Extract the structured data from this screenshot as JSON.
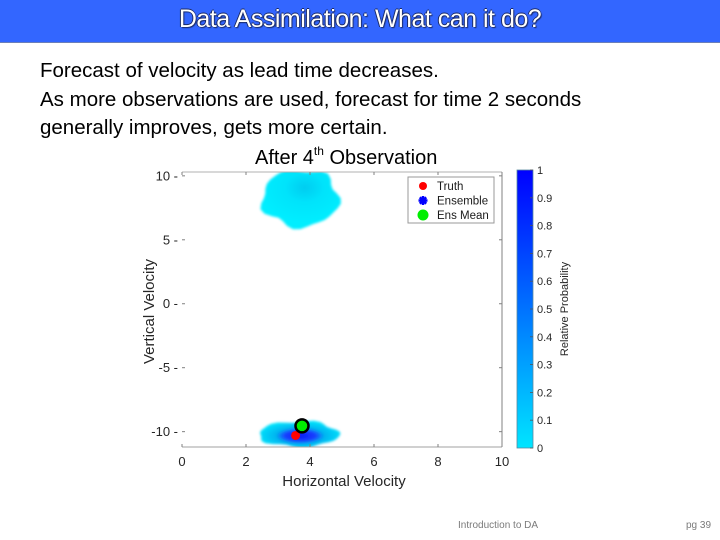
{
  "slide": {
    "title": "Data Assimilation: What can it do?",
    "body_lines": [
      "Forecast of velocity as lead time decreases.",
      "As more observations are used, forecast for time 2 seconds",
      "generally improves, gets more certain."
    ],
    "footer_left": "Introduction to DA",
    "footer_right": "pg 39"
  },
  "colors": {
    "title_bar": "#3366ff",
    "truth": "#ff0000",
    "ensemble": "#0000ff",
    "ens_mean": "#00ee00",
    "colormap_low": "#00e5ff",
    "colormap_high": "#0000ff"
  },
  "chart_data": {
    "type": "scatter",
    "title_prefix": "After 4",
    "title_sup": "th",
    "title_suffix": " Observation",
    "xlabel": "Horizontal Velocity",
    "ylabel": "Vertical Velocity",
    "xlim": [
      0,
      10
    ],
    "ylim": [
      -11.2,
      10.3
    ],
    "xticks": [
      "0",
      "2",
      "4",
      "6",
      "8",
      "10"
    ],
    "xtick_values": [
      0,
      2,
      4,
      6,
      8,
      10
    ],
    "yticks": [
      "10",
      "5",
      "0",
      "-5",
      "-10"
    ],
    "ytick_values": [
      10,
      5,
      0,
      -5,
      -10
    ],
    "grid": false,
    "legend": {
      "placement": "top-right",
      "entries": [
        "Truth",
        "Ensemble",
        "Ens Mean"
      ]
    },
    "colorbar": {
      "label": "Relative Probability",
      "range": [
        0,
        1
      ],
      "ticks": [
        "0",
        "0.1",
        "0.2",
        "0.3",
        "0.4",
        "0.5",
        "0.6",
        "0.7",
        "0.8",
        "0.9",
        "1"
      ],
      "tick_values": [
        0,
        0.1,
        0.2,
        0.3,
        0.4,
        0.5,
        0.6,
        0.7,
        0.8,
        0.9,
        1
      ]
    },
    "ensemble_clusters": [
      {
        "name": "upper-cluster",
        "x_range": [
          2.5,
          4.9
        ],
        "y_range": [
          6.2,
          10.3
        ],
        "center": [
          3.7,
          9.2
        ],
        "peak_probability": 0.15
      },
      {
        "name": "lower-cluster",
        "x_range": [
          2.4,
          4.9
        ],
        "y_range": [
          -11.2,
          -9.2
        ],
        "center": [
          3.8,
          -10.2
        ],
        "peak_probability": 0.85
      }
    ],
    "truth": {
      "x": 3.55,
      "y": -10.3
    },
    "ens_mean": {
      "x": 3.75,
      "y": -9.55
    }
  }
}
